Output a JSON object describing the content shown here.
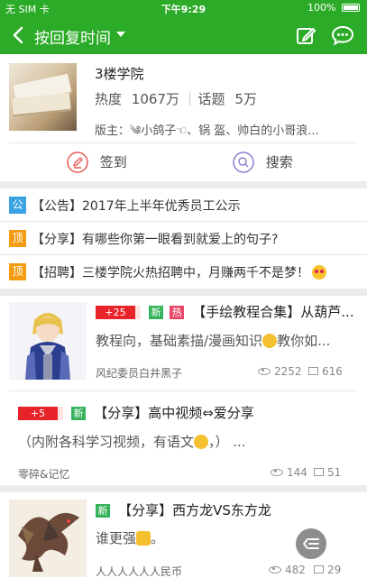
{
  "status_bar": {
    "carrier": "无 SIM 卡",
    "time": "下午9:29",
    "battery": "100%"
  },
  "nav": {
    "title": "按回复时间",
    "icons": [
      "back-chevron-icon",
      "caret-down-icon",
      "edit-icon",
      "message-icon"
    ]
  },
  "forum": {
    "name": "3楼学院",
    "heat_label": "热度",
    "heat_value": "1067万",
    "topic_label": "话题",
    "topic_value": "5万",
    "moderators": "版主：༄小鸽子☜、锅 盔、帅白的小哥浪..."
  },
  "actions": {
    "checkin_label": "签到",
    "search_label": "搜索"
  },
  "pinned": [
    {
      "badge": "公",
      "badge_color": "#3aa3e3",
      "text": "【公告】2017年上半年优秀员工公示"
    },
    {
      "badge": "顶",
      "badge_color": "#f39c12",
      "text": "【分享】有哪些你第一眼看到就爱上的句子?"
    },
    {
      "badge": "顶",
      "badge_color": "#f39c12",
      "text": "【招聘】三楼学院火热招聘中，月赚两千不是梦！"
    }
  ],
  "posts": [
    {
      "score_badge": "+25",
      "new_badge": "新",
      "hot_badge": "热",
      "title": "【手绘教程合集】从葫芦...",
      "body_pre": "教程向，基础素描/漫画知识",
      "body_post": "教你如...",
      "author": "风纪委员白井黑子",
      "views": "2252",
      "comments": "616"
    },
    {
      "score_badge": "+5",
      "new_badge": "新",
      "title": "【分享】高中视频⇔爱分享",
      "body_pre": "（内附各科学习视频，有语文",
      "body_post": "，）  ...",
      "author": "零碎&记忆",
      "views": "144",
      "comments": "51"
    },
    {
      "new_badge": "新",
      "title": "【分享】西方龙VS东方龙",
      "body_pre": "谁更强",
      "body_post": "。",
      "author": "人人人人人人民币",
      "views": "482",
      "comments": "29"
    }
  ],
  "colors": {
    "brand_green": "#2bab27",
    "score_red": "#e8242a",
    "new_green": "#35b35a",
    "hot_pink": "#e8496b"
  }
}
